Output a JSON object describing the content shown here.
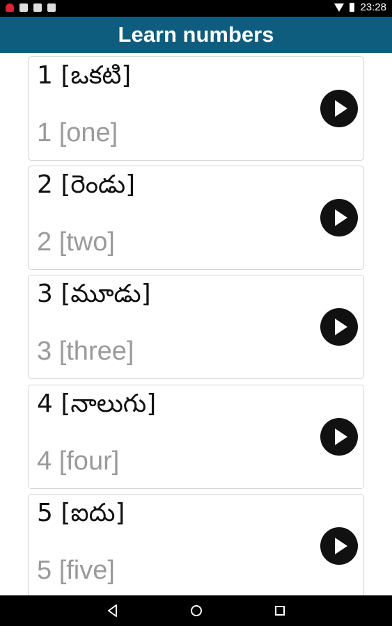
{
  "status_bar": {
    "time": "23:28",
    "left_icons": [
      "app-notification-icon",
      "gmail-icon",
      "image-icon",
      "news-icon"
    ],
    "right_icons": [
      "wifi-icon",
      "battery-icon"
    ]
  },
  "app_bar": {
    "title": "Learn numbers",
    "color": "#0e5d7f"
  },
  "numbers": [
    {
      "native": "1 [ఒకటి]",
      "english": "1 [one]"
    },
    {
      "native": "2 [రెండు]",
      "english": "2 [two]"
    },
    {
      "native": "3 [మూడు]",
      "english": "3 [three]"
    },
    {
      "native": "4 [నాలుగు]",
      "english": "4 [four]"
    },
    {
      "native": "5 [ఐదు]",
      "english": "5 [five]"
    }
  ],
  "nav_bar": {
    "buttons": [
      "back-icon",
      "home-icon",
      "recent-apps-icon"
    ]
  }
}
